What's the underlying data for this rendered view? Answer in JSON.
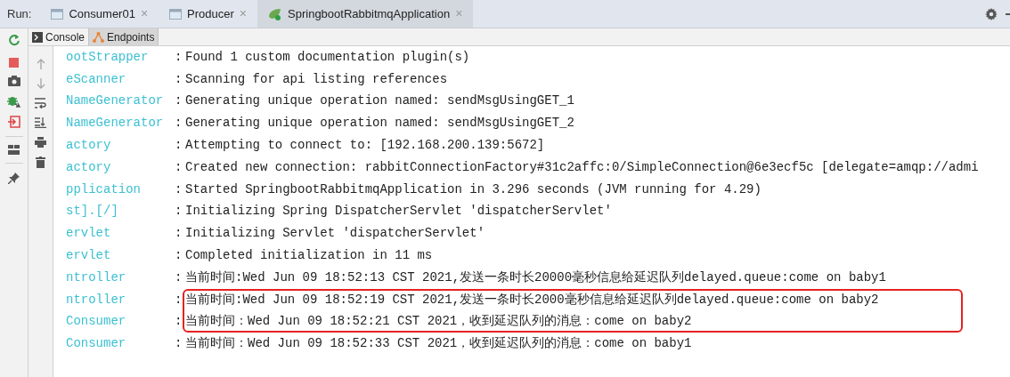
{
  "run_label": "Run:",
  "run_tabs": [
    {
      "label": "Consumer01",
      "kind": "app",
      "close": "×",
      "selected": false
    },
    {
      "label": "Producer",
      "kind": "app",
      "close": "×",
      "selected": false
    },
    {
      "label": "SpringbootRabbitmqApplication",
      "kind": "spring",
      "close": "×",
      "selected": true
    }
  ],
  "tool_tabs": [
    {
      "label": "Console",
      "kind": "console",
      "selected": false
    },
    {
      "label": "Endpoints",
      "kind": "endpoints",
      "selected": true
    }
  ],
  "log": [
    {
      "logger": "ootStrapper",
      "separator": ":",
      "message": "Found 1 custom documentation plugin(s)",
      "highlighted": false
    },
    {
      "logger": "eScanner",
      "separator": ":",
      "message": "Scanning for api listing references",
      "highlighted": false
    },
    {
      "logger": "NameGenerator",
      "separator": ":",
      "message": "Generating unique operation named: sendMsgUsingGET_1",
      "highlighted": false
    },
    {
      "logger": "NameGenerator",
      "separator": ":",
      "message": "Generating unique operation named: sendMsgUsingGET_2",
      "highlighted": false
    },
    {
      "logger": "actory",
      "separator": ":",
      "message": "Attempting to connect to: [192.168.200.139:5672]",
      "highlighted": false
    },
    {
      "logger": "actory",
      "separator": ":",
      "message": "Created new connection: rabbitConnectionFactory#31c2affc:0/SimpleConnection@6e3ecf5c [delegate=amqp://admi",
      "highlighted": false
    },
    {
      "logger": "pplication",
      "separator": ":",
      "message": "Started SpringbootRabbitmqApplication in 3.296 seconds (JVM running for 4.29)",
      "highlighted": false
    },
    {
      "logger": "st].[/]",
      "separator": ":",
      "message": "Initializing Spring DispatcherServlet 'dispatcherServlet'",
      "highlighted": false
    },
    {
      "logger": "ervlet",
      "separator": ":",
      "message": "Initializing Servlet 'dispatcherServlet'",
      "highlighted": false
    },
    {
      "logger": "ervlet",
      "separator": ":",
      "message": "Completed initialization in 11 ms",
      "highlighted": false
    },
    {
      "logger": "ntroller",
      "separator": ":",
      "message": "当前时间:Wed Jun 09 18:52:13 CST 2021,发送一条时长20000毫秒信息给延迟队列delayed.queue:come on baby1",
      "highlighted": false
    },
    {
      "logger": "ntroller",
      "separator": ":",
      "message": "当前时间:Wed Jun 09 18:52:19 CST 2021,发送一条时长2000毫秒信息给延迟队列delayed.queue:come on baby2",
      "highlighted": true
    },
    {
      "logger": "Consumer",
      "separator": ":",
      "message": "当前时间：Wed Jun 09 18:52:21 CST 2021，收到延迟队列的消息：come on baby2",
      "highlighted": true
    },
    {
      "logger": "Consumer",
      "separator": ":",
      "message": "当前时间：Wed Jun 09 18:52:33 CST 2021，收到延迟队列的消息：come on baby1",
      "highlighted": false
    }
  ]
}
